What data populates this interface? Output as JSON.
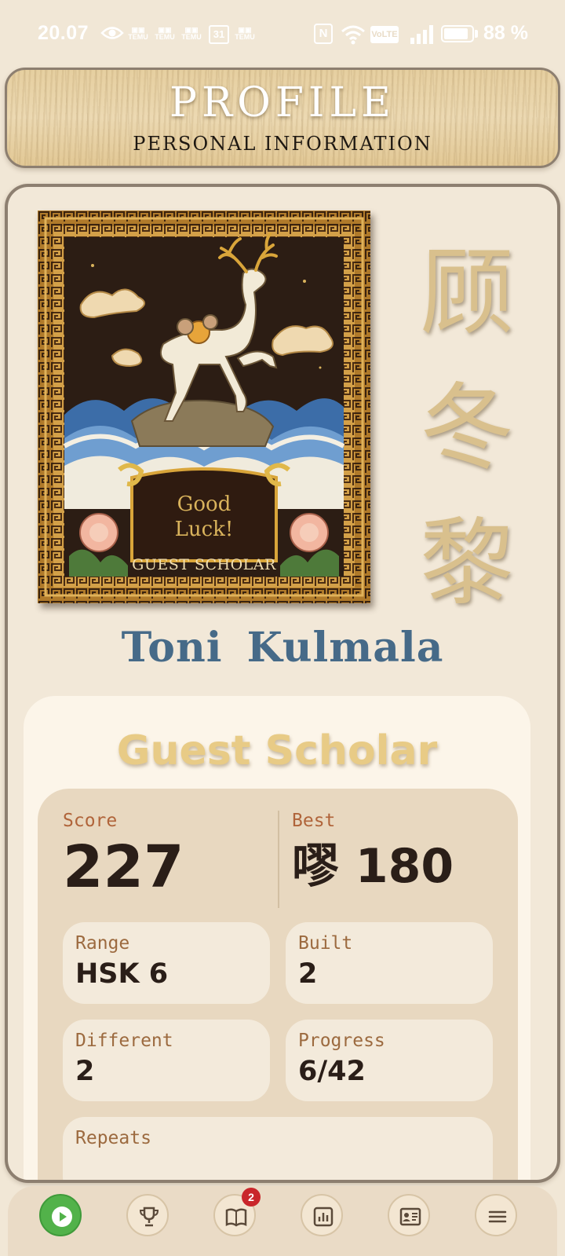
{
  "status_bar": {
    "time": "20.07",
    "app_label": "TEMU",
    "calendar_day": "31",
    "nfc_label": "N",
    "volte_label": "VoLTE",
    "battery_percent": 88,
    "battery_text": "88 %",
    "icons": [
      "eye-icon",
      "temu-icon",
      "calendar-icon",
      "nfc-icon",
      "wifi-icon",
      "volte-icon",
      "signal-icon",
      "battery-icon"
    ]
  },
  "header": {
    "title": "PROFILE",
    "subtitle": "PERSONAL INFORMATION"
  },
  "profile": {
    "portrait_text_line1": "Good",
    "portrait_text_line2": "Luck!",
    "portrait_caption": "GUEST SCHOLAR",
    "chinese_name": [
      "顾",
      "冬",
      "黎"
    ],
    "name": "Toni Kulmala",
    "rank": "Guest Scholar"
  },
  "stats": {
    "score_label": "Score",
    "score_value": "227",
    "best_label": "Best",
    "best_value": "嘐 180",
    "tiles": [
      {
        "label": "Range",
        "value": "HSK 6"
      },
      {
        "label": "Built",
        "value": "2"
      },
      {
        "label": "Different",
        "value": "2"
      },
      {
        "label": "Progress",
        "value": "6/42"
      },
      {
        "label": "Repeats",
        "value": ""
      }
    ]
  },
  "bottom_nav": {
    "items": [
      "play-icon",
      "trophy-icon",
      "book-icon",
      "chart-icon",
      "id-card-icon",
      "menu-icon"
    ],
    "badge_count": "2",
    "active_color": "#52b24a",
    "badge_color": "#c9262b"
  },
  "colors": {
    "background": "#f1e7d6",
    "name_blue": "#466a88",
    "gold": "#e8cb86",
    "label_brown": "#b0643a"
  }
}
